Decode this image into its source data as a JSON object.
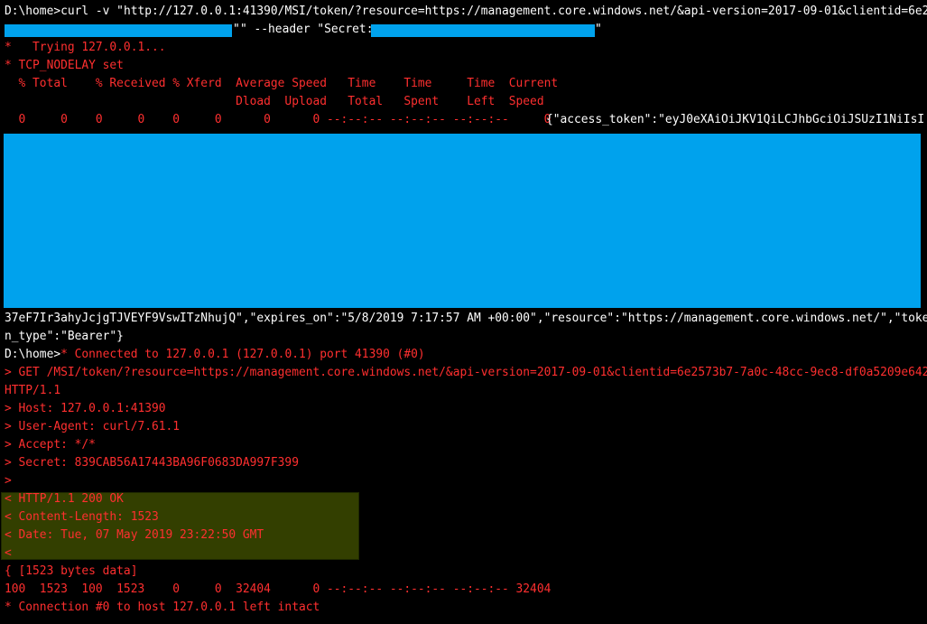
{
  "colors": {
    "background": "#000000",
    "stdout": "#ffffff",
    "stderr": "#ff2f2f",
    "redaction": "#00a2ed",
    "highlight": "#333f00"
  },
  "terminal": {
    "command": {
      "prompt": "D:\\home>",
      "cmd_part1": "curl -v \"http://127.0.0.1:41390/MSI/token/?resource=https://management.core.windows.net/&api-version=2017-09-01&clientid=6e2",
      "cmd_part2_start": "\"",
      "cmd_part2_mid": "\" --header \"Secret: ",
      "cmd_part2_end": "\""
    },
    "trying": "*   Trying 127.0.0.1...",
    "nodelay": "* TCP_NODELAY set",
    "progress_header_1": "  % Total    % Received % Xferd  Average Speed   Time    Time     Time  Current",
    "progress_header_2": "                                 Dload  Upload   Total   Spent    Left  Speed",
    "progress_zero_1": "  0     0    0     0    0     0      0      0 --:--:-- --:--:-- --:--:--     0",
    "progress_zero_2": "{\"access_token\":\"eyJ0eXAiOiJKV1QiLCJhbGciOiJSUzI1NiIsI",
    "token_tail_1": "37eF7Ir3ahyJcjgTJVEYF9VswITzNhujQ\",\"expires_on\":\"5/8/2019 7:17:57 AM +00:00\",\"resource\":\"https://management.core.windows.net/\",\"toke",
    "token_tail_2": "n_type\":\"Bearer\"}",
    "second_prompt": "D:\\home>",
    "connected": "* Connected to 127.0.0.1 (127.0.0.1) port 41390 (#0)",
    "get_1": "> GET /MSI/token/?resource=https://management.core.windows.net/&api-version=2017-09-01&clientid=6e2573b7-7a0c-48cc-9ec8-df0a5209e642",
    "get_2": "HTTP/1.1",
    "host": "> Host: 127.0.0.1:41390",
    "user_agent": "> User-Agent: curl/7.61.1",
    "accept": "> Accept: */*",
    "secret": "> Secret: 839CAB56A17443BA96F0683DA997F399",
    "req_end": ">",
    "resp_status": "< HTTP/1.1 200 OK",
    "resp_length": "< Content-Length: 1523",
    "resp_date": "< Date: Tue, 07 May 2019 23:22:50 GMT",
    "resp_end": "<",
    "bytes_data": "{ [1523 bytes data]",
    "progress_final": "100  1523  100  1523    0     0  32404      0 --:--:-- --:--:-- --:--:-- 32404",
    "conn_intact": "* Connection #0 to host 127.0.0.1 left intact"
  }
}
